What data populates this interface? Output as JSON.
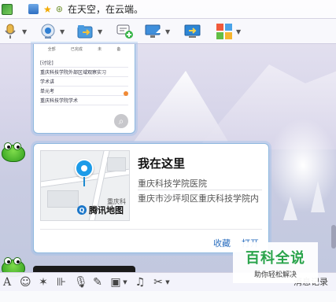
{
  "top_bar": {
    "status_text": "在天空，在云端。"
  },
  "toolbar": {
    "icons": [
      "microphone-icon",
      "webcam-icon",
      "file-transfer-icon",
      "message-add-icon",
      "screen-share-icon",
      "remote-desktop-icon",
      "apps-grid-icon"
    ]
  },
  "location_card": {
    "title": "我在这里",
    "place_name": "重庆科技学院医院",
    "address": "重庆市沙坪坝区重庆科技学院内",
    "map_brand": "腾讯地图",
    "map_label": "重庆科",
    "actions": {
      "save": "收藏",
      "open": "打开"
    }
  },
  "screenshot_preview": {
    "tabs": [
      "全部",
      "已完成",
      "未",
      "备"
    ],
    "rows": [
      "[讨论]",
      "重庆科技学院外部区域观察实习",
      "学术讲",
      "单元考",
      "重庆科技学院学术"
    ]
  },
  "input_toolbar": {
    "record_label": "消息记录"
  },
  "watermark": {
    "brand": "百科全说",
    "slogan": "助你轻松解决"
  },
  "colors": {
    "accent_blue": "#2c6fbf",
    "pin_blue": "#1c9be8",
    "bubble_border": "#8fb9df",
    "watermark_green": "#2aa44b"
  }
}
